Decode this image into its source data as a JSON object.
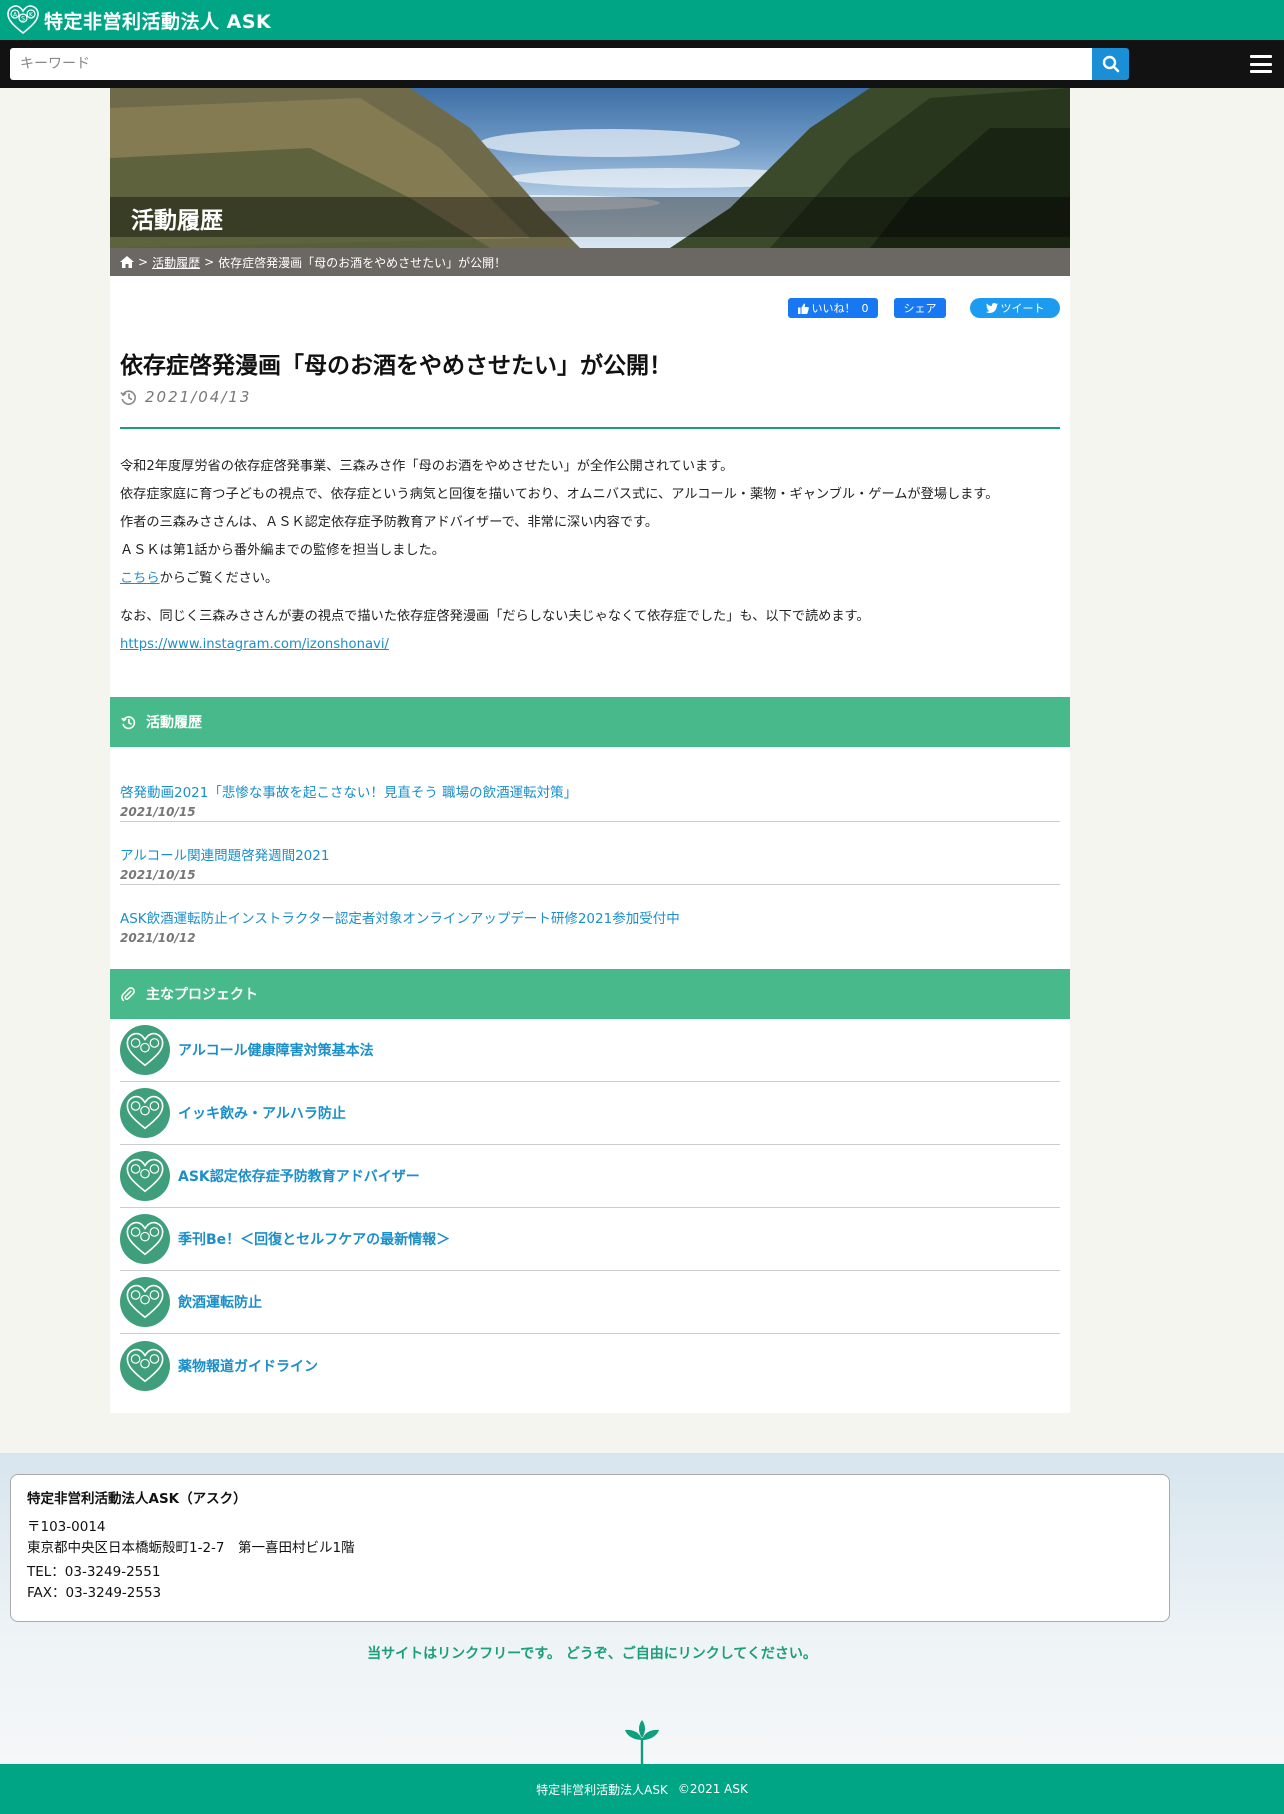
{
  "header": {
    "site_name": "特定非営利活動法人 ASK",
    "logo_letters": [
      "A",
      "S",
      "K"
    ],
    "accent_color": "#00a585"
  },
  "search": {
    "placeholder": "キーワード",
    "button_icon": "search-icon"
  },
  "menu": {
    "icon": "hamburger-menu-icon"
  },
  "hero": {
    "title": "活動履歴"
  },
  "breadcrumb": {
    "home_icon": "home-icon",
    "separator": ">",
    "items": [
      "活動履歴",
      "依存症啓発漫画「母のお酒をやめさせたい」が公開！"
    ]
  },
  "share": {
    "like_label": "いいね！",
    "like_count": "0",
    "share_label": "シェア",
    "tweet_label": "ツイート"
  },
  "article": {
    "title": "依存症啓発漫画「母のお酒をやめさせたい」が公開！",
    "date": "2021/04/13",
    "paragraphs": [
      "令和2年度厚労省の依存症啓発事業、三森みさ作「母のお酒をやめさせたい」が全作公開されています。",
      "依存症家庭に育つ子どもの視点で、依存症という病気と回復を描いており、オムニバス式に、アルコール・薬物・ギャンブル・ゲームが登場します。",
      "作者の三森みささんは、ＡＳＫ認定依存症予防教育アドバイザーで、非常に深い内容です。",
      "ＡＳＫは第1話から番外編までの監修を担当しました。"
    ],
    "link_text": "こちら",
    "link_suffix": "からご覧ください。",
    "note": "なお、同じく三森みささんが妻の視点で描いた依存症啓発漫画「だらしない夫じゃなくて依存症でした」も、以下で読めます。",
    "instagram_url": "https://www.instagram.com/izonshonavi/"
  },
  "history": {
    "heading": "活動履歴",
    "items": [
      {
        "title": "啓発動画2021「悲惨な事故を起こさない！見直そう 職場の飲酒運転対策」",
        "date": "2021/10/15"
      },
      {
        "title": "アルコール関連問題啓発週間2021",
        "date": "2021/10/15"
      },
      {
        "title": "ASK飲酒運転防止インストラクター認定者対象オンラインアップデート研修2021参加受付中",
        "date": "2021/10/12"
      }
    ]
  },
  "projects": {
    "heading": "主なプロジェクト",
    "items": [
      "アルコール健康障害対策基本法",
      "イッキ飲み・アルハラ防止",
      "ASK認定依存症予防教育アドバイザー",
      "季刊Be！＜回復とセルフケアの最新情報＞",
      "飲酒運転防止",
      "薬物報道ガイドライン"
    ]
  },
  "footer": {
    "org_name": "特定非営利活動法人ASK（アスク）",
    "zip": "〒103-0014",
    "address": "東京都中央区日本橋蛎殻町1-2-7　第一喜田村ビル1階",
    "tel": "TEL：03-3249-2551",
    "fax": "FAX：03-3249-2553",
    "link_free": "当サイトはリンクフリーです。 どうぞ、ご自由にリンクしてください。",
    "bottom_org": "特定非営利活動法人ASK",
    "copyright": "©2021 ASK"
  }
}
